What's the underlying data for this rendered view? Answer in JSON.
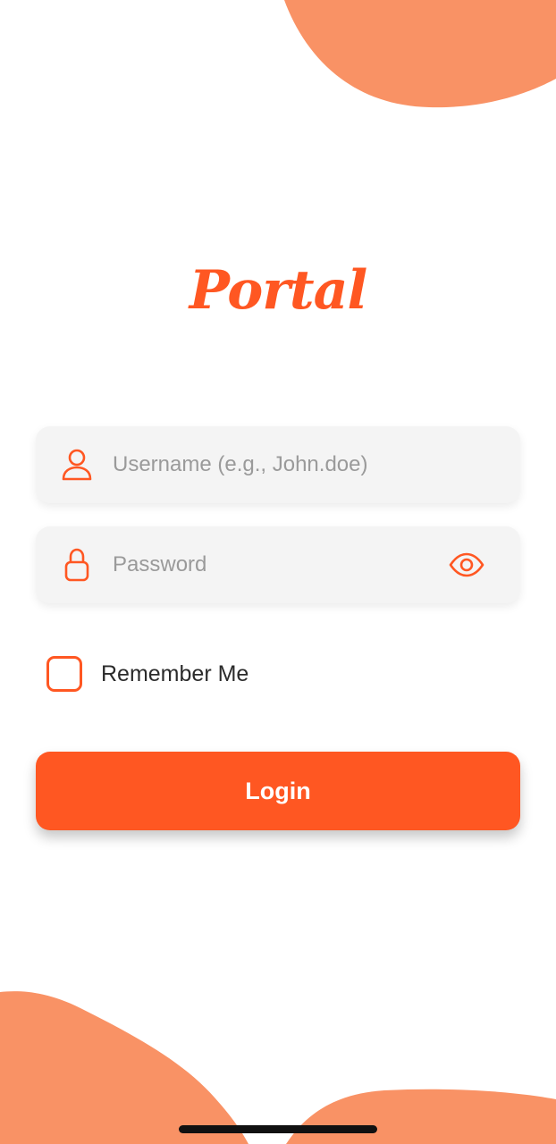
{
  "app": {
    "brand_name": "Portal"
  },
  "login_form": {
    "username": {
      "placeholder": "Username (e.g., John.doe)",
      "value": "",
      "icon": "user-icon"
    },
    "password": {
      "placeholder": "Password",
      "value": "",
      "icon": "lock-icon",
      "toggle_icon": "eye-icon"
    },
    "remember_me": {
      "label": "Remember Me",
      "checked": false
    },
    "login_button": {
      "label": "Login"
    }
  },
  "colors": {
    "accent": "#ff5722",
    "blob": "#f99265",
    "field_background": "#f4f4f4",
    "placeholder_text": "#9a9a9a",
    "body_text": "#2b2b2b",
    "background": "#ffffff"
  }
}
